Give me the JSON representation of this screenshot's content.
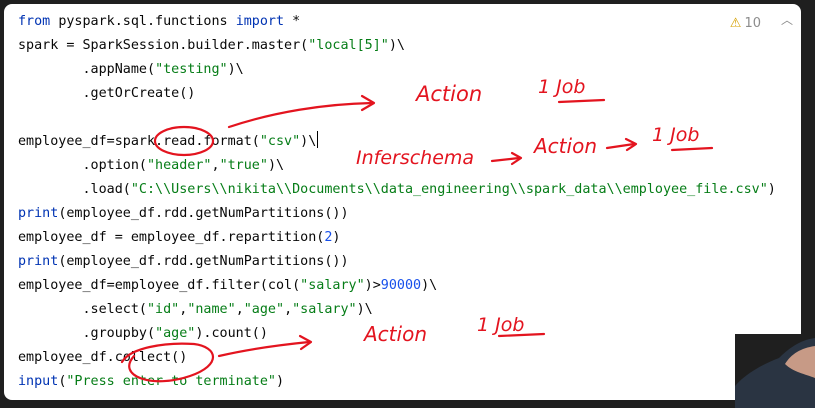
{
  "editor": {
    "warning_icon": "warning-triangle-icon",
    "warning_count": "10",
    "chevron_icon": "chevron-up-icon",
    "lines": [
      {
        "parts": [
          [
            "kw",
            "from "
          ],
          [
            "t",
            "pyspark.sql.functions "
          ],
          [
            "kw",
            "import "
          ],
          [
            "t",
            "*"
          ]
        ]
      },
      {
        "parts": [
          [
            "t",
            "spark = SparkSession.builder.master("
          ],
          [
            "str",
            "\"local[5]\""
          ],
          [
            "t",
            ")\\"
          ]
        ]
      },
      {
        "parts": [
          [
            "t",
            "        .appName("
          ],
          [
            "str",
            "\"testing\""
          ],
          [
            "t",
            ")\\"
          ]
        ]
      },
      {
        "parts": [
          [
            "t",
            "        .getOrCreate()"
          ]
        ]
      },
      {
        "parts": []
      },
      {
        "parts": [
          [
            "t",
            "employee_df=spark.read.format("
          ],
          [
            "str",
            "\"csv\""
          ],
          [
            "t",
            ")\\"
          ]
        ],
        "caret": true
      },
      {
        "parts": [
          [
            "t",
            "        .option("
          ],
          [
            "str",
            "\"header\""
          ],
          [
            "t",
            ","
          ],
          [
            "str",
            "\"true\""
          ],
          [
            "t",
            ")\\"
          ]
        ]
      },
      {
        "parts": [
          [
            "t",
            "        .load("
          ],
          [
            "str",
            "\"C:\\\\Users\\\\nikita\\\\Documents\\\\data_engineering\\\\spark_data\\\\employee_file.csv\""
          ],
          [
            "t",
            ")"
          ]
        ]
      },
      {
        "parts": [
          [
            "kw",
            "print"
          ],
          [
            "t",
            "(employee_df.rdd.getNumPartitions())"
          ]
        ]
      },
      {
        "parts": [
          [
            "t",
            "employee_df = employee_df.repartition("
          ],
          [
            "num",
            "2"
          ],
          [
            "t",
            ")"
          ]
        ]
      },
      {
        "parts": [
          [
            "kw",
            "print"
          ],
          [
            "t",
            "(employee_df.rdd.getNumPartitions())"
          ]
        ]
      },
      {
        "parts": [
          [
            "t",
            "employee_df=employee_df.filter(col("
          ],
          [
            "str",
            "\"salary\""
          ],
          [
            "t",
            ")>"
          ],
          [
            "num",
            "90000"
          ],
          [
            "t",
            ")\\"
          ]
        ]
      },
      {
        "parts": [
          [
            "t",
            "        .select("
          ],
          [
            "str",
            "\"id\""
          ],
          [
            "t",
            ","
          ],
          [
            "str",
            "\"name\""
          ],
          [
            "t",
            ","
          ],
          [
            "str",
            "\"age\""
          ],
          [
            "t",
            ","
          ],
          [
            "str",
            "\"salary\""
          ],
          [
            "t",
            ")\\"
          ]
        ]
      },
      {
        "parts": [
          [
            "t",
            "        .groupby("
          ],
          [
            "str",
            "\"age\""
          ],
          [
            "t",
            ").count()"
          ]
        ]
      },
      {
        "parts": [
          [
            "t",
            "employee_df.collect()"
          ]
        ]
      },
      {
        "parts": [
          [
            "kw",
            "input"
          ],
          [
            "t",
            "("
          ],
          [
            "str",
            "\"Press enter to terminate\""
          ],
          [
            "t",
            ")"
          ]
        ]
      }
    ]
  },
  "annotations": {
    "a1": "Action",
    "b1": "1 Job",
    "a2": "Inferschema",
    "b2": "Action",
    "c2": "1 Job",
    "a3": "Action",
    "b3": "1 Job"
  },
  "colors": {
    "keyword": "#0033b3",
    "string": "#067d17",
    "number": "#1750eb",
    "annotation": "#e3141f"
  }
}
